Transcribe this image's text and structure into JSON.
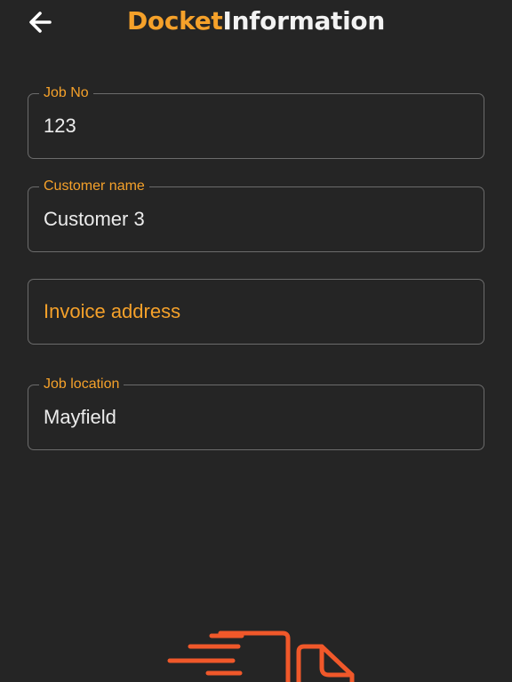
{
  "colors": {
    "accent": "#f5a12a",
    "illustration": "#f0582a",
    "background": "#252525"
  },
  "header": {
    "back_icon": "arrow-left-icon",
    "title_part1": "Docket",
    "title_part2": "Information"
  },
  "form": {
    "job_no": {
      "label": "Job No",
      "value": "123"
    },
    "customer_name": {
      "label": "Customer name",
      "value": "Customer 3"
    },
    "invoice_address": {
      "placeholder": "Invoice address",
      "value": ""
    },
    "job_location": {
      "label": "Job location",
      "value": "Mayfield"
    }
  },
  "illustration": {
    "icon": "fast-document-delivery-icon"
  }
}
